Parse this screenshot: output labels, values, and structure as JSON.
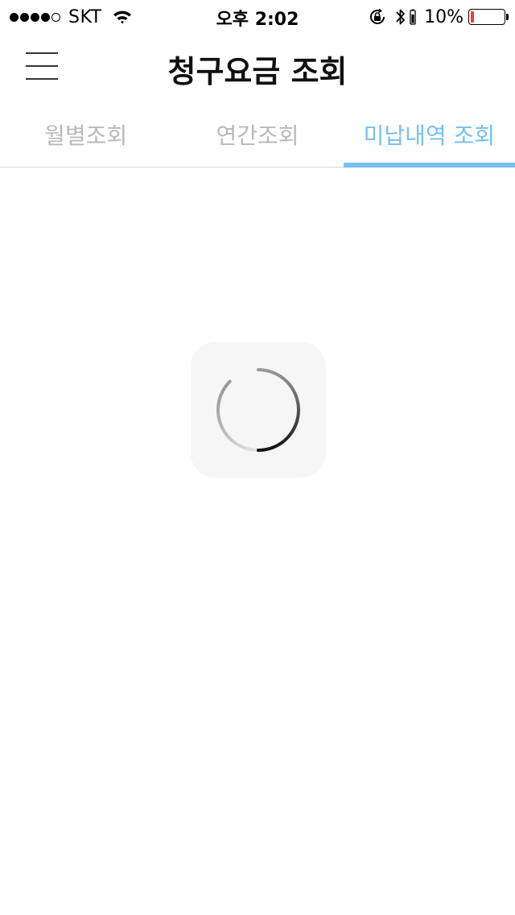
{
  "status_bar": {
    "signal_filled": 4,
    "signal_total": 5,
    "carrier": "SKT",
    "time": "오후 2:02",
    "battery_percent_label": "10%",
    "battery_level": 0.1,
    "battery_color": "#ff3b30"
  },
  "header": {
    "title": "청구요금 조회"
  },
  "tabs": [
    {
      "label": "월별조회",
      "active": false
    },
    {
      "label": "연간조회",
      "active": false
    },
    {
      "label": "미납내역 조회",
      "active": true
    }
  ],
  "colors": {
    "accent": "#74c0f4",
    "inactive_tab": "#b9b9b9"
  },
  "loader": {
    "icon": "spinner-icon"
  }
}
